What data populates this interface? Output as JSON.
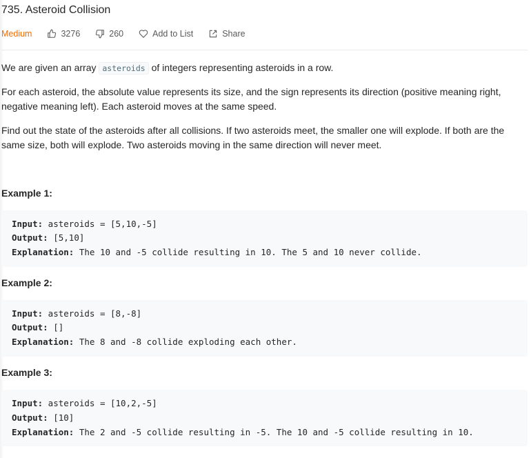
{
  "problem": {
    "title": "735. Asteroid Collision",
    "difficulty": "Medium",
    "likes": "3276",
    "dislikes": "260",
    "add_to_list": "Add to List",
    "share": "Share"
  },
  "description": {
    "p1_before": "We are given an array",
    "p1_code": "asteroids",
    "p1_after": "of integers representing asteroids in a row.",
    "p2": "For each asteroid, the absolute value represents its size, and the sign represents its direction (positive meaning right, negative meaning left). Each asteroid moves at the same speed.",
    "p3": "Find out the state of the asteroids after all collisions. If two asteroids meet, the smaller one will explode. If both are the same size, both will explode. Two asteroids moving in the same direction will never meet."
  },
  "examples": [
    {
      "title": "Example 1:",
      "input_label": "Input:",
      "input": " asteroids = [5,10,-5]",
      "output_label": "Output:",
      "output": " [5,10]",
      "explanation_label": "Explanation:",
      "explanation": " The 10 and -5 collide resulting in 10. The 5 and 10 never collide."
    },
    {
      "title": "Example 2:",
      "input_label": "Input:",
      "input": " asteroids = [8,-8]",
      "output_label": "Output:",
      "output": " []",
      "explanation_label": "Explanation:",
      "explanation": " The 8 and -8 collide exploding each other."
    },
    {
      "title": "Example 3:",
      "input_label": "Input:",
      "input": " asteroids = [10,2,-5]",
      "output_label": "Output:",
      "output": " [10]",
      "explanation_label": "Explanation:",
      "explanation": " The 2 and -5 collide resulting in -5. The 10 and -5 collide resulting in 10."
    }
  ],
  "colors": {
    "difficulty_medium": "#ef6c00",
    "code_background": "#f7f9fa",
    "text": "#262626",
    "meta_text": "#595959"
  },
  "icons": [
    "thumbs-up-icon",
    "thumbs-down-icon",
    "heart-icon",
    "share-icon"
  ]
}
